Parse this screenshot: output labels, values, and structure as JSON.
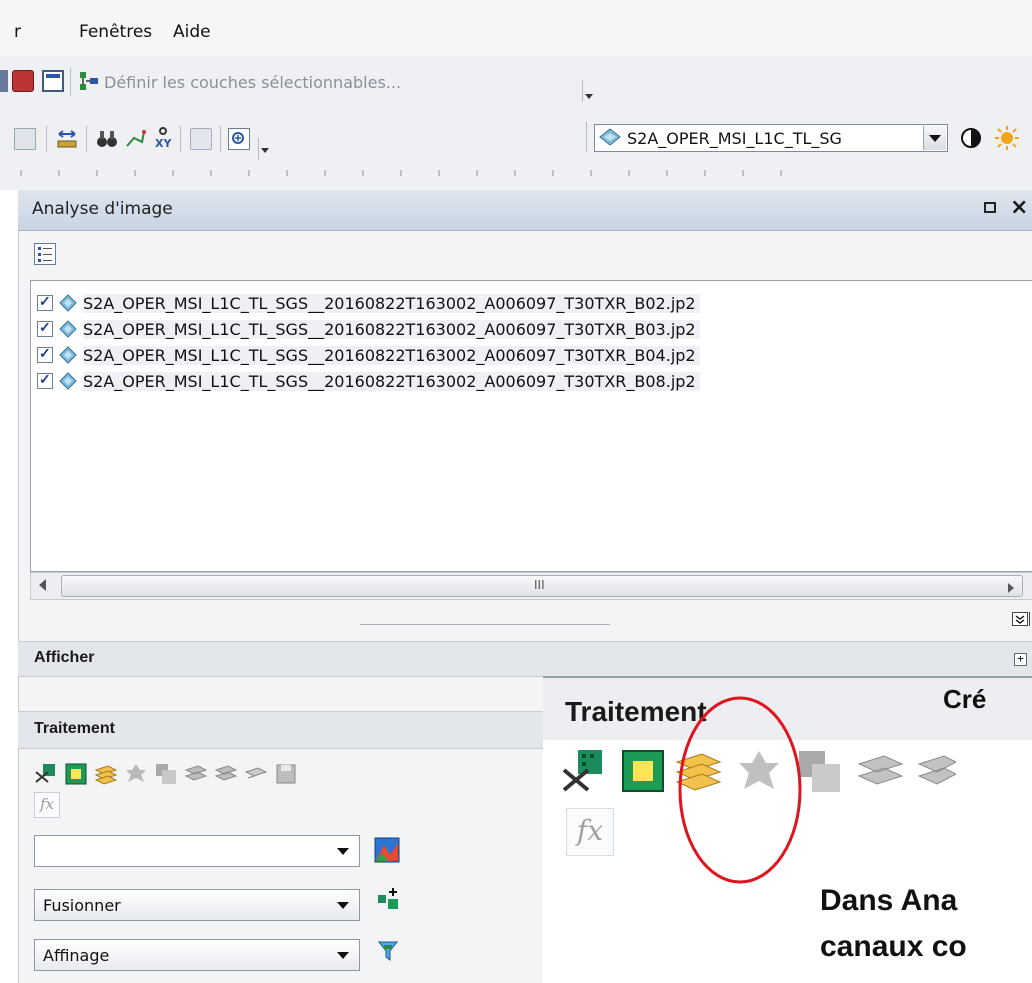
{
  "menubar": {
    "items": [
      {
        "label": "r"
      },
      {
        "label": "Fenêtres"
      },
      {
        "label": "Aide"
      }
    ]
  },
  "toolbar1": {
    "selectable_layers_label": "Définir les couches sélectionnables..."
  },
  "toolbar2": {
    "layer_dropdown_value": "S2A_OPER_MSI_L1C_TL_SG"
  },
  "panel": {
    "title": "Analyse d'image",
    "layers": [
      {
        "name": "S2A_OPER_MSI_L1C_TL_SGS__20160822T163002_A006097_T30TXR_B02.jp2",
        "checked": true
      },
      {
        "name": "S2A_OPER_MSI_L1C_TL_SGS__20160822T163002_A006097_T30TXR_B03.jp2",
        "checked": true
      },
      {
        "name": "S2A_OPER_MSI_L1C_TL_SGS__20160822T163002_A006097_T30TXR_B04.jp2",
        "checked": true
      },
      {
        "name": "S2A_OPER_MSI_L1C_TL_SGS__20160822T163002_A006097_T30TXR_B08.jp2",
        "checked": true
      }
    ],
    "scroll_thumb_label": "III",
    "sections": {
      "display": "Afficher",
      "processing": "Traitement"
    },
    "combos": {
      "empty": "",
      "fusion": "Fusionner",
      "refine": "Affinage"
    }
  },
  "zoom_inset": {
    "title": "Traitement",
    "note_right": "Cré",
    "text_line1": "Dans Ana",
    "text_line2": "canaux co"
  },
  "colors": {
    "highlight_circle": "#e0141e",
    "panel_title_bg": "#c9d4e3"
  }
}
